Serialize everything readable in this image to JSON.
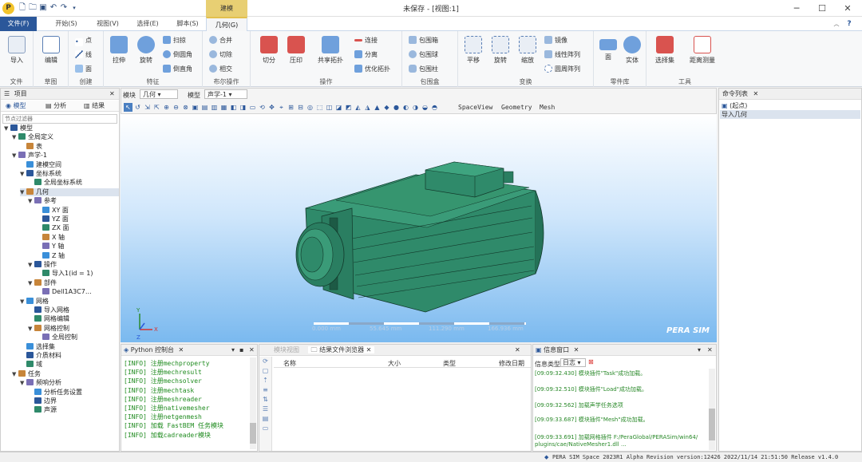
{
  "title": "未保存 - [视图:1]",
  "context_tab": "建模",
  "tabs": [
    "文件(F)",
    "开始(S)",
    "视图(V)",
    "选择(E)",
    "脚本(S)",
    "几何(G)"
  ],
  "ribbon": {
    "groups": [
      "文件",
      "草图",
      "创建",
      "特征",
      "布尔操作",
      "操作",
      "包围盒",
      "变换",
      "零件库",
      "工具"
    ],
    "import": "导入",
    "edit": "编辑",
    "point": "点",
    "line": "线",
    "face": "面",
    "extrude": "拉伸",
    "revolve": "旋转",
    "sweep": "扫掠",
    "fillet": "倒圆角",
    "chamfer": "倒直角",
    "union": "合并",
    "cut": "切除",
    "intersect": "相交",
    "split": "切分",
    "press": "压印",
    "share": "共享拓扑",
    "connect": "连接",
    "separate": "分离",
    "optimize": "优化拓扑",
    "bbox_box": "包围箱",
    "bbox_sphere": "包围球",
    "bbox_cyl": "包围柱",
    "translate": "平移",
    "rotate": "旋转",
    "scale": "缩放",
    "mirror": "镜像",
    "linear_array": "线性阵列",
    "circ_array": "圆周阵列",
    "face_lib": "面",
    "solid_lib": "实体",
    "select_set": "选择集",
    "measure": "距离测量"
  },
  "project": {
    "title": "项目",
    "tabs": [
      "模型",
      "分析",
      "结果"
    ],
    "filter_placeholder": "节点过滤器",
    "nodes": [
      {
        "t": "模型",
        "d": 0,
        "tg": "▼"
      },
      {
        "t": "全局定义",
        "d": 1,
        "tg": "▼"
      },
      {
        "t": "表",
        "d": 2,
        "tg": ""
      },
      {
        "t": "声学-1",
        "d": 1,
        "tg": "▼"
      },
      {
        "t": "建模空间",
        "d": 2,
        "tg": ""
      },
      {
        "t": "坐标系统",
        "d": 2,
        "tg": "▼"
      },
      {
        "t": "全局坐标系统",
        "d": 3,
        "tg": ""
      },
      {
        "t": "几何",
        "d": 2,
        "tg": "▼",
        "sel": true
      },
      {
        "t": "参考",
        "d": 3,
        "tg": "▼"
      },
      {
        "t": "XY 面",
        "d": 4,
        "tg": ""
      },
      {
        "t": "YZ 面",
        "d": 4,
        "tg": ""
      },
      {
        "t": "ZX 面",
        "d": 4,
        "tg": ""
      },
      {
        "t": "X 轴",
        "d": 4,
        "tg": ""
      },
      {
        "t": "Y 轴",
        "d": 4,
        "tg": ""
      },
      {
        "t": "Z 轴",
        "d": 4,
        "tg": ""
      },
      {
        "t": "操作",
        "d": 3,
        "tg": "▼"
      },
      {
        "t": "导入1(id = 1)",
        "d": 4,
        "tg": ""
      },
      {
        "t": "部件",
        "d": 3,
        "tg": "▼"
      },
      {
        "t": "Dell1A3C7…",
        "d": 4,
        "tg": ""
      },
      {
        "t": "网格",
        "d": 2,
        "tg": "▼"
      },
      {
        "t": "导入网格",
        "d": 3,
        "tg": ""
      },
      {
        "t": "网格编辑",
        "d": 3,
        "tg": ""
      },
      {
        "t": "网格控制",
        "d": 3,
        "tg": "▼"
      },
      {
        "t": "全局控制",
        "d": 4,
        "tg": ""
      },
      {
        "t": "选择集",
        "d": 2,
        "tg": ""
      },
      {
        "t": "介质材料",
        "d": 2,
        "tg": ""
      },
      {
        "t": "域",
        "d": 2,
        "tg": ""
      },
      {
        "t": "任务",
        "d": 1,
        "tg": "▼"
      },
      {
        "t": "频响分析",
        "d": 2,
        "tg": "▼"
      },
      {
        "t": "分析任务设置",
        "d": 3,
        "tg": ""
      },
      {
        "t": "边界",
        "d": 3,
        "tg": ""
      },
      {
        "t": "声源",
        "d": 3,
        "tg": ""
      }
    ]
  },
  "view_toolbar": {
    "mode_label": "模块",
    "mode_value": "几何",
    "model_label": "模型",
    "model_value": "声学-1",
    "links": [
      "SpaceView",
      "Geometry",
      "Mesh"
    ]
  },
  "scale": [
    "0.000 mm",
    "55.645 mm",
    "111.290 mm",
    "166.936 mm"
  ],
  "brand": "PERA SIM",
  "cmd": {
    "title": "命令列表",
    "items": [
      "(起点)",
      "导入几何"
    ]
  },
  "python": {
    "title": "Python 控制台",
    "lines": [
      "[INFO] 注册mechproperty",
      "[INFO] 注册mechresult",
      "[INFO] 注册mechsolver",
      "[INFO] 注册mechtask",
      "[INFO] 注册meshreader",
      "[INFO] 注册nativemesher",
      "[INFO] 注册netgenmesh",
      "[INFO] 加载 FastBEM 任务模块",
      "[INFO] 加载cadreader模块"
    ]
  },
  "files": {
    "tabs": [
      "模块视图",
      "结果文件浏览器"
    ],
    "cols": [
      "名称",
      "大小",
      "类型",
      "修改日期"
    ]
  },
  "info": {
    "title": "信息窗口",
    "type_label": "信息类型",
    "type_value": "日志",
    "messages": [
      "[09:09:32.430] 模块插件\"Task\"成功加载。",
      "[09:09:32.510] 模块插件\"Load\"成功加载。",
      "[09:09:32.562] 加载声学任务选项",
      "[09:09:33.687] 模块插件\"Mesh\"成功加载。",
      "[09:09:33.691] 加载网格插件 F:/PeraGlobal/PERASim/win64/ plugins/cae/NativeMesher1.dll ..."
    ]
  },
  "status": "PERA SIM Space 2023R1 Alpha Revision version:12426 2022/11/14 21:51:50 Release v1.4.0",
  "colors": {
    "file_tab": "#2b579a",
    "context": "#e8cf73",
    "model": "#2f8a6a",
    "bg_top": "#ffffff",
    "bg_bottom": "#7ab9ef"
  }
}
